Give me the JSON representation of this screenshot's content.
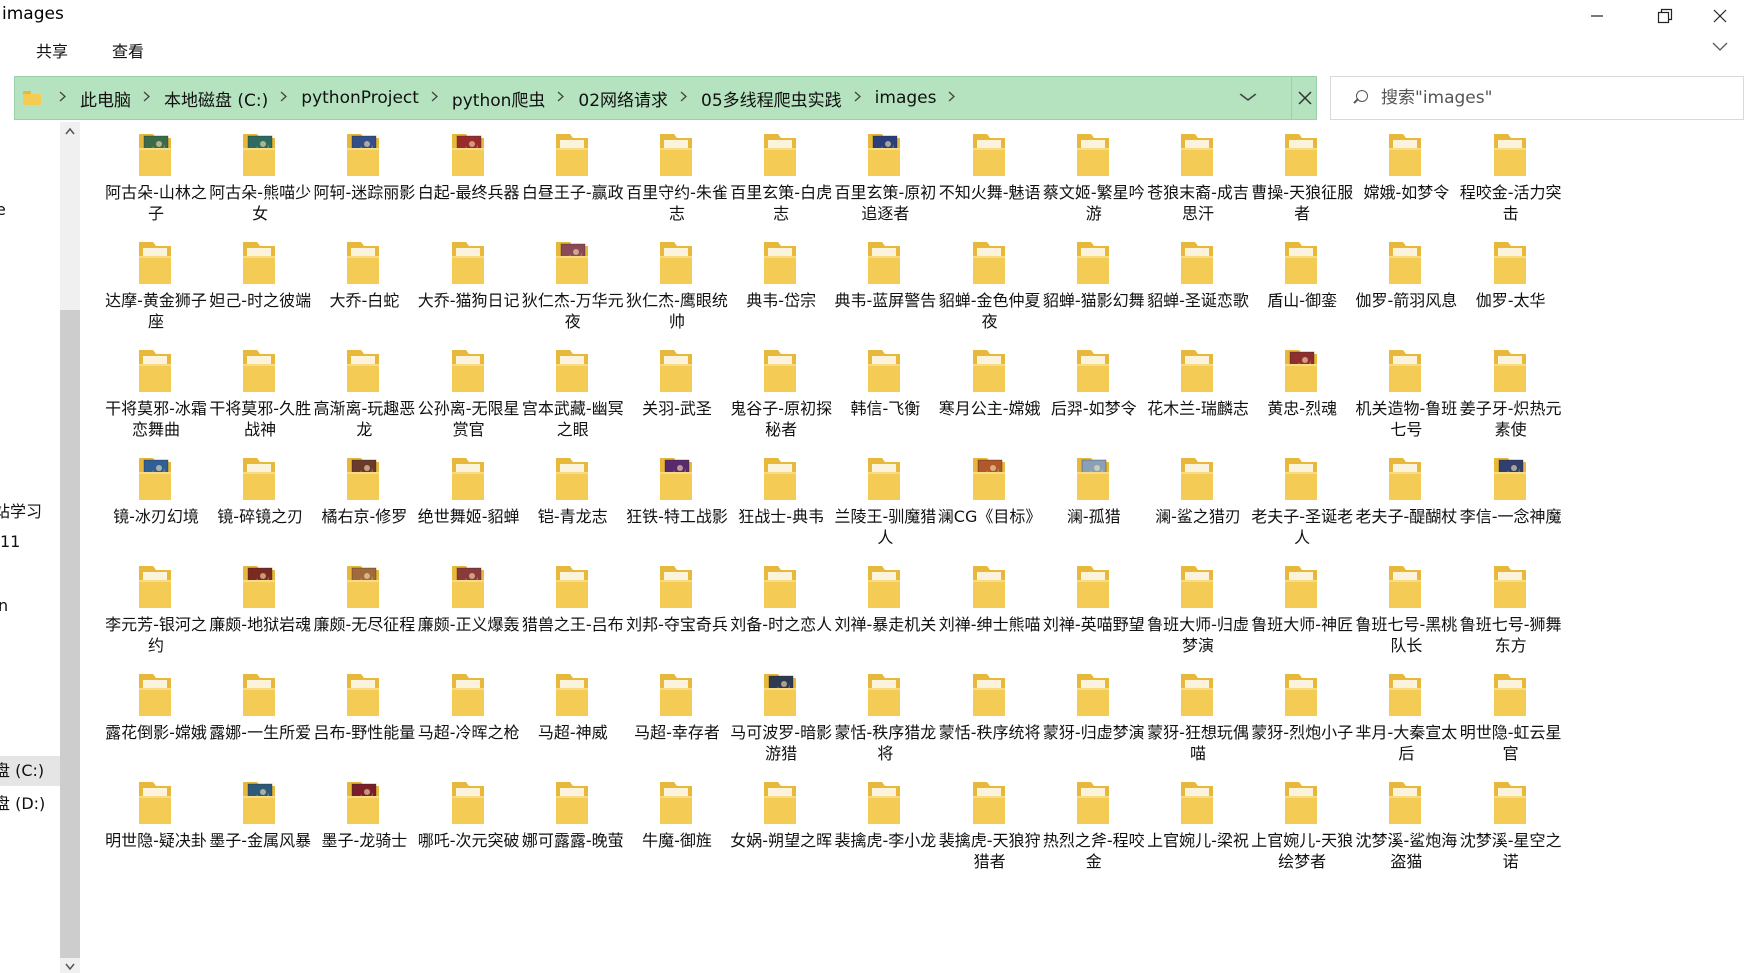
{
  "window": {
    "title": "images",
    "ribbon_tabs": [
      "共享",
      "查看"
    ]
  },
  "address": {
    "crumbs": [
      "此电脑",
      "本地磁盘 (C:)",
      "pythonProject",
      "python爬虫",
      "02网络请求",
      "05多线程爬虫实践",
      "images"
    ]
  },
  "search": {
    "placeholder": "搜索\"images\""
  },
  "nav": {
    "items": [
      {
        "label": "e"
      },
      {
        "label": "站学习"
      },
      {
        "label": "11"
      },
      {
        "label": "n"
      },
      {
        "label": "盘 (C:)",
        "selected": true
      },
      {
        "label": "盘 (D:)"
      }
    ]
  },
  "colors": {
    "address_bg": "#b5e3bf",
    "folder": "#f3cb55",
    "folder_dark": "#e8b83a",
    "selected": "#e5e5e5"
  },
  "files": [
    {
      "name": "阿古朵-山林之子",
      "thumb": true,
      "tint": "#3d6b4a"
    },
    {
      "name": "阿古朵-熊喵少女",
      "thumb": true,
      "tint": "#2f6a5e"
    },
    {
      "name": "阿轲-迷踪丽影",
      "thumb": true,
      "tint": "#334e88"
    },
    {
      "name": "白起-最终兵器",
      "thumb": true,
      "tint": "#9a2b2b"
    },
    {
      "name": "白昼王子-赢政"
    },
    {
      "name": "百里守约-朱雀志"
    },
    {
      "name": "百里玄策-白虎志"
    },
    {
      "name": "百里玄策-原初追逐者",
      "thumb": true,
      "tint": "#2b3f7a"
    },
    {
      "name": "不知火舞-魅语"
    },
    {
      "name": "蔡文姬-繁星吟游"
    },
    {
      "name": "苍狼末裔-成吉思汗"
    },
    {
      "name": "曹操-天狼征服者"
    },
    {
      "name": "嫦娥-如梦令"
    },
    {
      "name": "程咬金-活力突击"
    },
    {
      "name": "达摩-黄金狮子座"
    },
    {
      "name": "妲己-时之彼端"
    },
    {
      "name": "大乔-白蛇"
    },
    {
      "name": "大乔-猫狗日记"
    },
    {
      "name": "狄仁杰-万华元夜",
      "thumb": true,
      "tint": "#8a4a55"
    },
    {
      "name": "狄仁杰-鹰眼统帅"
    },
    {
      "name": "典韦-岱宗"
    },
    {
      "name": "典韦-蓝屏警告"
    },
    {
      "name": "貂蝉-金色仲夏夜"
    },
    {
      "name": "貂蝉-猫影幻舞"
    },
    {
      "name": "貂蝉-圣诞恋歌"
    },
    {
      "name": "盾山-御銮"
    },
    {
      "name": "伽罗-箭羽风息"
    },
    {
      "name": "伽罗-太华"
    },
    {
      "name": "干将莫邪-冰霜恋舞曲"
    },
    {
      "name": "干将莫邪-久胜战神"
    },
    {
      "name": "高渐离-玩趣恶龙"
    },
    {
      "name": "公孙离-无限星赏官"
    },
    {
      "name": "宫本武藏-幽冥之眼"
    },
    {
      "name": "关羽-武圣"
    },
    {
      "name": "鬼谷子-原初探秘者"
    },
    {
      "name": "韩信-飞衡"
    },
    {
      "name": "寒月公主-嫦娥"
    },
    {
      "name": "后羿-如梦令"
    },
    {
      "name": "花木兰-瑞麟志"
    },
    {
      "name": "黄忠-烈魂",
      "thumb": true,
      "tint": "#8e2f2f"
    },
    {
      "name": "机关造物-鲁班七号"
    },
    {
      "name": "姜子牙-炽热元素使"
    },
    {
      "name": "镜-冰刃幻境",
      "thumb": true,
      "tint": "#2f5f94"
    },
    {
      "name": "镜-碎镜之刃"
    },
    {
      "name": "橘右京-修罗",
      "thumb": true,
      "tint": "#6a3b2a"
    },
    {
      "name": "绝世舞姬-貂蝉"
    },
    {
      "name": "铠-青龙志"
    },
    {
      "name": "狂铁-特工战影",
      "thumb": true,
      "tint": "#5a2a6e"
    },
    {
      "name": "狂战士-典韦"
    },
    {
      "name": "兰陵王-驯魔猎人"
    },
    {
      "name": "澜CG《目标》",
      "thumb": true,
      "tint": "#b0582a"
    },
    {
      "name": "澜-孤猎",
      "thumb": true,
      "tint": "#8aa0b8"
    },
    {
      "name": "澜-鲨之猎刃"
    },
    {
      "name": "老夫子-圣诞老人"
    },
    {
      "name": "老夫子-醍醐杖"
    },
    {
      "name": "李信-一念神魔",
      "thumb": true,
      "tint": "#30406e"
    },
    {
      "name": "李元芳-银河之约"
    },
    {
      "name": "廉颇-地狱岩魂",
      "thumb": true,
      "tint": "#7a2a22"
    },
    {
      "name": "廉颇-无尽征程",
      "thumb": true,
      "tint": "#a06a3a"
    },
    {
      "name": "廉颇-正义爆轰",
      "thumb": true,
      "tint": "#8a3a3a"
    },
    {
      "name": "猎兽之王-吕布"
    },
    {
      "name": "刘邦-夺宝奇兵"
    },
    {
      "name": "刘备-时之恋人"
    },
    {
      "name": "刘禅-暴走机关"
    },
    {
      "name": "刘禅-绅士熊喵"
    },
    {
      "name": "刘禅-英喵野望"
    },
    {
      "name": "鲁班大师-归虚梦演"
    },
    {
      "name": "鲁班大师-神匠"
    },
    {
      "name": "鲁班七号-黑桃队长"
    },
    {
      "name": "鲁班七号-狮舞东方"
    },
    {
      "name": "露花倒影-嫦娥"
    },
    {
      "name": "露娜-一生所爱"
    },
    {
      "name": "吕布-野性能量"
    },
    {
      "name": "马超-冷晖之枪"
    },
    {
      "name": "马超-神威"
    },
    {
      "name": "马超-幸存者"
    },
    {
      "name": "马可波罗-暗影游猎",
      "thumb": true,
      "tint": "#2e3a52"
    },
    {
      "name": "蒙恬-秩序猎龙将"
    },
    {
      "name": "蒙恬-秩序统将"
    },
    {
      "name": "蒙犽-归虚梦演"
    },
    {
      "name": "蒙犽-狂想玩偶喵"
    },
    {
      "name": "蒙犽-烈炮小子"
    },
    {
      "name": "芈月-大秦宣太后"
    },
    {
      "name": "明世隐-虹云星官"
    },
    {
      "name": "明世隐-疑决卦"
    },
    {
      "name": "墨子-金属风暴",
      "thumb": true,
      "tint": "#2e5a7a"
    },
    {
      "name": "墨子-龙骑士",
      "thumb": true,
      "tint": "#7a1f2a"
    },
    {
      "name": "哪吒-次元突破"
    },
    {
      "name": "娜可露露-晚萤"
    },
    {
      "name": "牛魔-御旌"
    },
    {
      "name": "女娲-朔望之晖"
    },
    {
      "name": "裴擒虎-李小龙"
    },
    {
      "name": "裴擒虎-天狼狩猎者"
    },
    {
      "name": "热烈之斧-程咬金"
    },
    {
      "name": "上官婉儿-梁祝"
    },
    {
      "name": "上官婉儿-天狼绘梦者"
    },
    {
      "name": "沈梦溪-鲨炮海盗猫"
    },
    {
      "name": "沈梦溪-星空之诺"
    }
  ]
}
